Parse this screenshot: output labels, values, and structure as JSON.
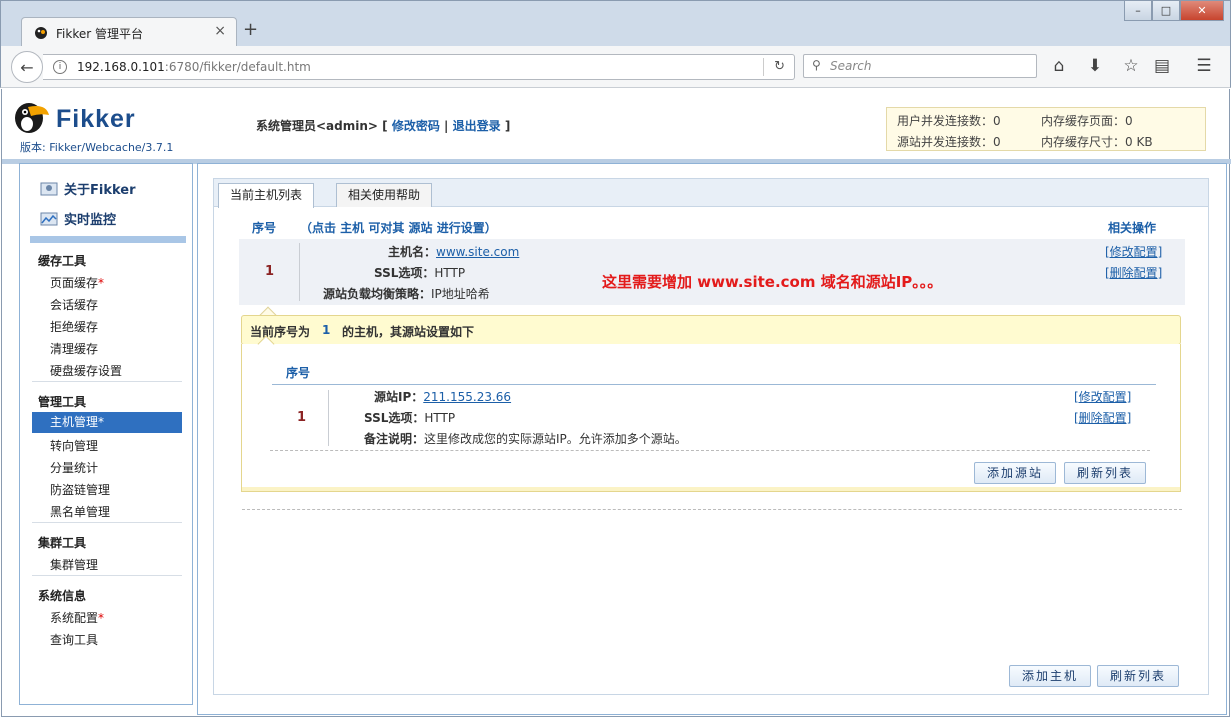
{
  "browser": {
    "tab_title": "Fikker 管理平台",
    "new_tab": "+",
    "url_host": "192.168.0.101",
    "url_rest": ":6780/fikker/default.htm",
    "search_placeholder": "Search",
    "window_buttons": [
      "–",
      "□",
      "✕"
    ]
  },
  "header": {
    "logo_text": "Fikker",
    "version": "版本: Fikker/Webcache/3.7.1",
    "admin_label": "系统管理员<admin>",
    "change_password": "修改密码",
    "logout": "退出登录",
    "bracket_open": "[",
    "bracket_close": "]",
    "pipe": "|",
    "stats": {
      "user_conn": "用户并发连接数：0",
      "origin_conn": "源站并发连接数：0",
      "mem_pages": "内存缓存页面：0",
      "mem_size": "内存缓存尺寸：0 KB"
    }
  },
  "sidebar": {
    "about": "关于Fikker",
    "monitor": "实时监控",
    "groups": {
      "cache": "缓存工具",
      "manage": "管理工具",
      "cluster": "集群工具",
      "system": "系统信息"
    },
    "cache_items": [
      "页面缓存",
      "会话缓存",
      "拒绝缓存",
      "清理缓存",
      "硬盘缓存设置"
    ],
    "manage_items": [
      "主机管理",
      "转向管理",
      "分量统计",
      "防盗链管理",
      "黑名单管理"
    ],
    "cluster_items": [
      "集群管理"
    ],
    "system_items": [
      "系统配置",
      "查询工具"
    ],
    "star": "*"
  },
  "main": {
    "tabs": [
      "当前主机列表",
      "相关使用帮助"
    ],
    "col_index": "序号",
    "col_hint": "（点击 主机 可对其 源站 进行设置）",
    "col_ops": "相关操作",
    "host": {
      "index": "1",
      "hostname_label": "主机名：",
      "hostname": "www.site.com",
      "ssl_label": "SSL选项：",
      "ssl": "HTTP",
      "lb_label": "源站负载均衡策略：",
      "lb": "IP地址哈希",
      "edit": "[修改配置]",
      "delete": "[删除配置]"
    },
    "annotation": "这里需要增加 www.site.com 域名和源站IP。。。",
    "current_prefix": "当前序号为",
    "current_index": "1",
    "current_suffix": "的主机，其源站设置如下",
    "origin": {
      "col_index": "序号",
      "index": "1",
      "ip_label": "源站IP：",
      "ip": "211.155.23.66",
      "ssl_label": "SSL选项：",
      "ssl": "HTTP",
      "note_label": "备注说明：",
      "note": "这里修改成您的实际源站IP。允许添加多个源站。",
      "edit": "[修改配置]",
      "delete": "[删除配置]",
      "add_btn": "添加源站",
      "refresh_btn": "刷新列表"
    },
    "add_host_btn": "添加主机",
    "refresh_btn": "刷新列表"
  }
}
